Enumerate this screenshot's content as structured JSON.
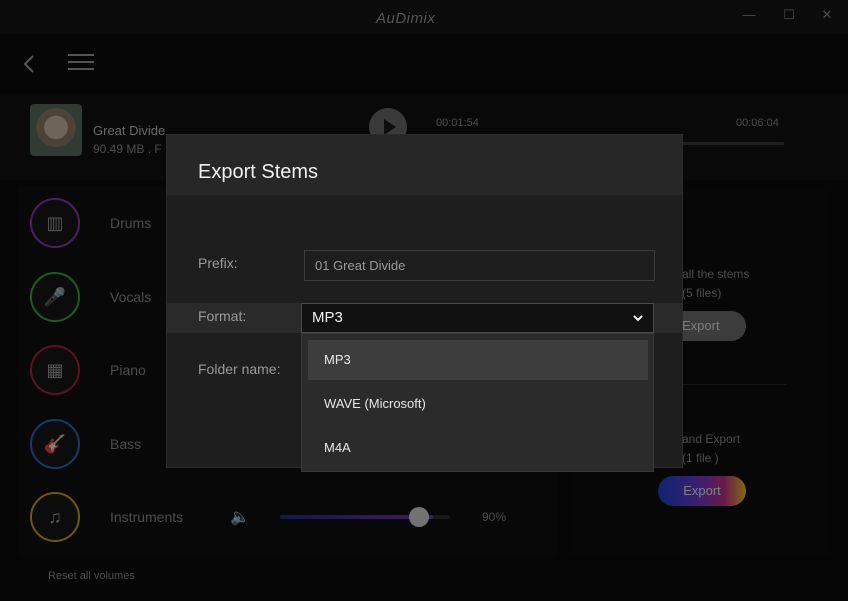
{
  "window": {
    "app_name": "AuDimix",
    "minimize_glyph": "—",
    "maximize_glyph": "☐",
    "close_glyph": "✕"
  },
  "song": {
    "title": "Great Divide",
    "meta": "90.49 MB . F",
    "current_time": "00:01:54",
    "total_time": "00:06:04"
  },
  "stems": [
    {
      "label": "Drums",
      "icon": "drum-icon",
      "glyph": "▥",
      "color": "#8a3ab8"
    },
    {
      "label": "Vocals",
      "icon": "microphone-icon",
      "glyph": "🎤",
      "color": "#3aa83a"
    },
    {
      "label": "Piano",
      "icon": "piano-icon",
      "glyph": "▦",
      "color": "#b02040"
    },
    {
      "label": "Bass",
      "icon": "guitar-icon",
      "glyph": "🎸",
      "color": "#2a6ab8"
    },
    {
      "label": "Instruments",
      "icon": "instruments-icon",
      "glyph": "♫",
      "color": "#c8a020",
      "volume_pct": "90%",
      "volume_level": 0.9
    }
  ],
  "reset_label": "Reset all volumes",
  "export_panel": {
    "all_stems_line1": "all the stems",
    "all_stems_line2": "(5 files)",
    "export_all_label": "Export",
    "mix_line1": "and Export",
    "mix_line2": "(1 file )",
    "export_mix_label": "Export"
  },
  "dialog": {
    "title": "Export Stems",
    "prefix_label": "Prefix:",
    "prefix_value": "01 Great Divide",
    "format_label": "Format:",
    "format_value": "MP3",
    "folder_label": "Folder name:",
    "format_options": [
      "MP3",
      "WAVE (Microsoft)",
      "M4A"
    ],
    "selected_option_index": 0
  },
  "colors": {
    "background": "#0b0b0b",
    "dialog_bg": "#1e1e1e",
    "accent_gradient": [
      "#1e3fd0",
      "#6a3ad0",
      "#c0308a",
      "#e8c020"
    ]
  }
}
